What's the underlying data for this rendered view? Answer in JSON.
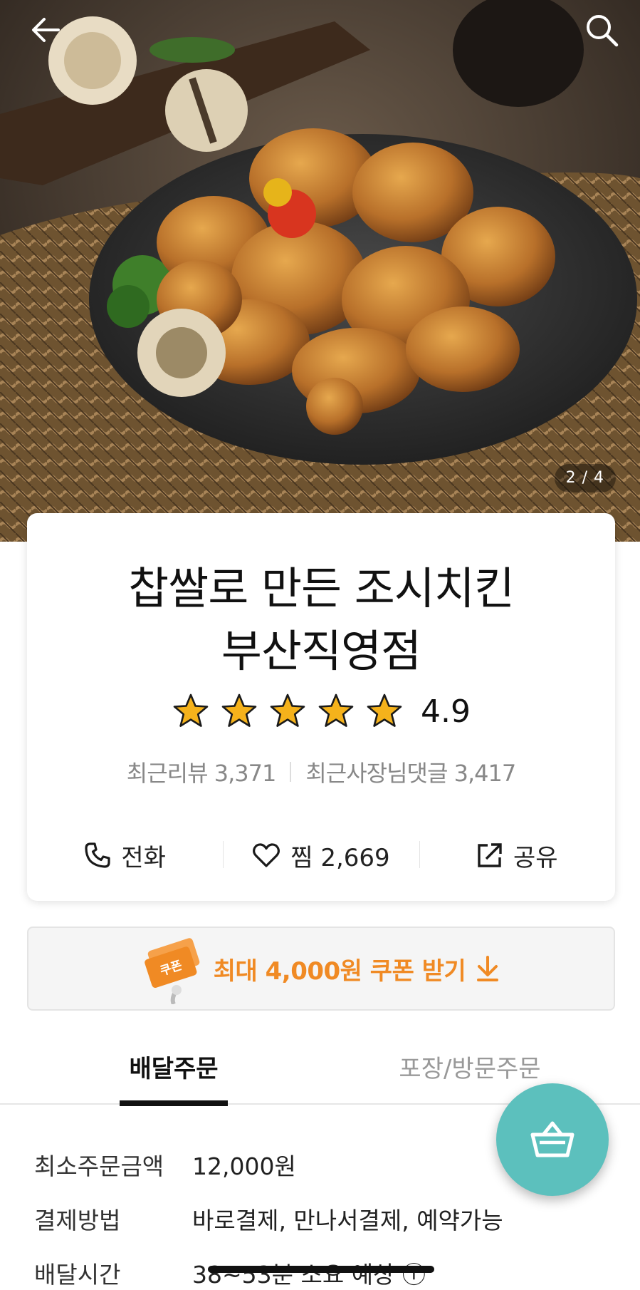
{
  "hero": {
    "image_counter": "2 / 4",
    "icons": {
      "back": "arrow-left-icon",
      "search": "search-icon"
    }
  },
  "store": {
    "name_line1": "찹쌀로 만든 조시치킨",
    "name_line2": "부산직영점",
    "rating": "4.9",
    "star_count": 5,
    "recent_reviews": "최근리뷰 3,371",
    "owner_replies": "최근사장님댓글 3,417"
  },
  "actions": {
    "call": "전화",
    "favorite": "찜 2,669",
    "share": "공유"
  },
  "coupon": {
    "badge": "쿠폰",
    "text": "최대 4,000원 쿠폰 받기"
  },
  "tabs": {
    "delivery": "배달주문",
    "pickup": "포장/방문주문"
  },
  "info": {
    "rows": [
      {
        "label": "최소주문금액",
        "value": "12,000원"
      },
      {
        "label": "결제방법",
        "value": "바로결제, 만나서결제, 예약가능"
      },
      {
        "label": "배달시간",
        "value": "38~53분 소요 예상 ⓘ"
      }
    ]
  },
  "colors": {
    "accent_orange": "#f08a24",
    "cart_teal": "#5cc0bd",
    "star_gold": "#f5b21b"
  }
}
